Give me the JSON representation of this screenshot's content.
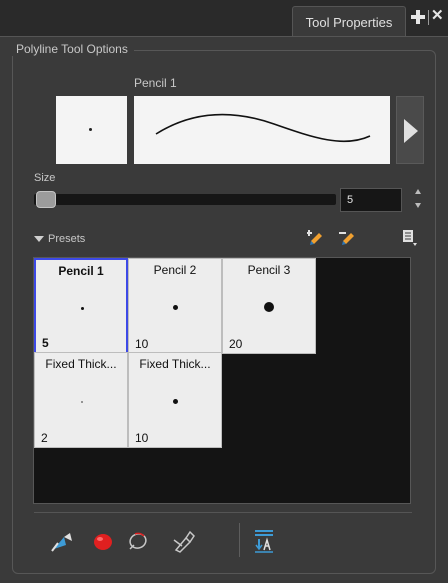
{
  "tab": {
    "title": "Tool Properties"
  },
  "panel": {
    "group_title": "Polyline Tool Options",
    "preview_preset_name": "Pencil 1"
  },
  "size": {
    "label": "Size",
    "value": "5"
  },
  "presets": {
    "label": "Presets",
    "items": [
      {
        "name": "Pencil 1",
        "size": "5"
      },
      {
        "name": "Pencil 2",
        "size": "10"
      },
      {
        "name": "Pencil 3",
        "size": "20"
      },
      {
        "name": "Fixed Thick...",
        "size": "2"
      },
      {
        "name": "Fixed Thick...",
        "size": "10"
      }
    ],
    "selected_index": 0
  },
  "colors": {
    "accent_selection": "#3d49e6",
    "panel_bg": "#3a3a3a",
    "icon_blue": "#3d9bd6",
    "icon_red": "#e02020",
    "icon_orange": "#f0a030"
  },
  "icons": {
    "toolbar": [
      "arrow-icon",
      "brush-toggle-icon",
      "lasso-icon",
      "pencil-eraser-icon",
      "stroke-order-icon"
    ],
    "presets": [
      "new-preset-icon",
      "delete-preset-icon",
      "presets-menu-icon"
    ]
  }
}
